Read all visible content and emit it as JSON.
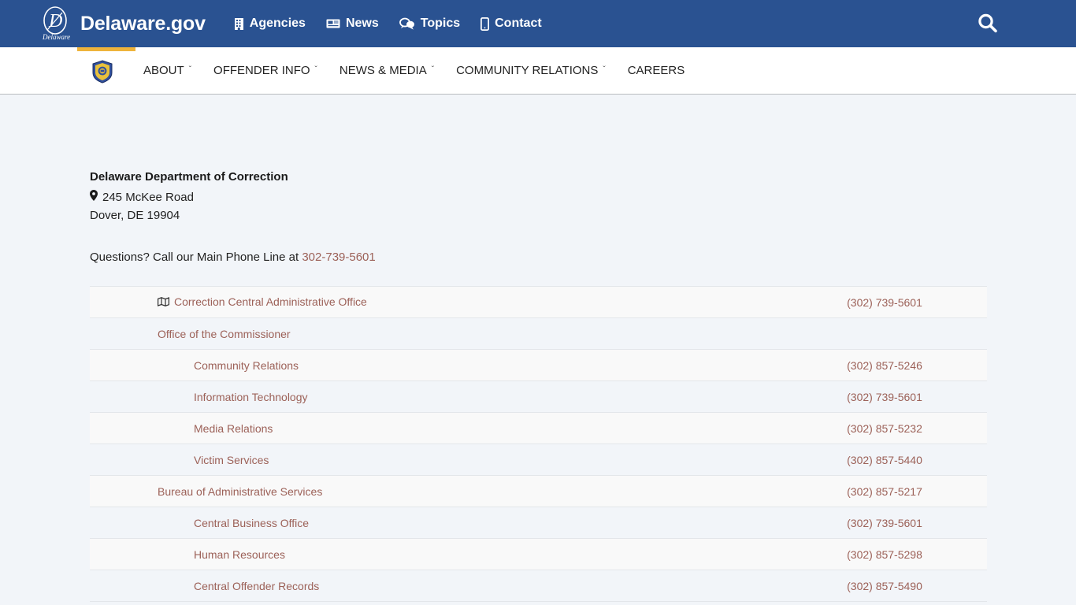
{
  "state_bar": {
    "brand_name": "Delaware.gov",
    "brand_logo_letter": "D",
    "brand_logo_sub": "Delaware",
    "nav": [
      {
        "label": "Agencies",
        "icon": "building-icon"
      },
      {
        "label": "News",
        "icon": "newspaper-icon"
      },
      {
        "label": "Topics",
        "icon": "speech-bubbles-icon"
      },
      {
        "label": "Contact",
        "icon": "mobile-phone-icon"
      }
    ],
    "search_icon": "search-icon",
    "background": "#2a5291"
  },
  "agency_nav": {
    "logo_alt": "doc-shield-logo",
    "accent_color": "#eeb33b",
    "items": [
      {
        "label": "ABOUT",
        "has_dropdown": true
      },
      {
        "label": "OFFENDER INFO",
        "has_dropdown": true
      },
      {
        "label": "NEWS & MEDIA",
        "has_dropdown": true
      },
      {
        "label": "COMMUNITY RELATIONS",
        "has_dropdown": true
      },
      {
        "label": "CAREERS",
        "has_dropdown": false
      }
    ],
    "caret_glyph": "ˇ"
  },
  "address": {
    "org_name": "Delaware Department of Correction",
    "street": "245 McKee Road",
    "city_state_zip": "Dover, DE 19904",
    "map_pin_icon": "location-pin-icon",
    "questions_prefix": "Questions? Call our Main Phone Line at ",
    "main_phone": "302-739-5601"
  },
  "directory": {
    "link_color": "#9c6158",
    "rows": [
      {
        "name": "Correction Central Administrative Office",
        "phone": "(302) 739-5601",
        "indent": 1,
        "icon": "map-icon"
      },
      {
        "name": "Office of the Commissioner",
        "phone": "",
        "indent": 1,
        "icon": ""
      },
      {
        "name": "Community Relations",
        "phone": "(302) 857-5246",
        "indent": 2,
        "icon": ""
      },
      {
        "name": "Information Technology",
        "phone": "(302) 739-5601",
        "indent": 2,
        "icon": ""
      },
      {
        "name": "Media Relations",
        "phone": "(302) 857-5232",
        "indent": 2,
        "icon": ""
      },
      {
        "name": "Victim Services",
        "phone": "(302) 857-5440",
        "indent": 2,
        "icon": ""
      },
      {
        "name": "Bureau of Administrative Services",
        "phone": "(302) 857-5217",
        "indent": 1,
        "icon": ""
      },
      {
        "name": "Central Business Office",
        "phone": "(302) 739-5601",
        "indent": 2,
        "icon": ""
      },
      {
        "name": "Human Resources",
        "phone": "(302) 857-5298",
        "indent": 2,
        "icon": ""
      },
      {
        "name": "Central Offender Records",
        "phone": "(302) 857-5490",
        "indent": 2,
        "icon": ""
      }
    ]
  }
}
